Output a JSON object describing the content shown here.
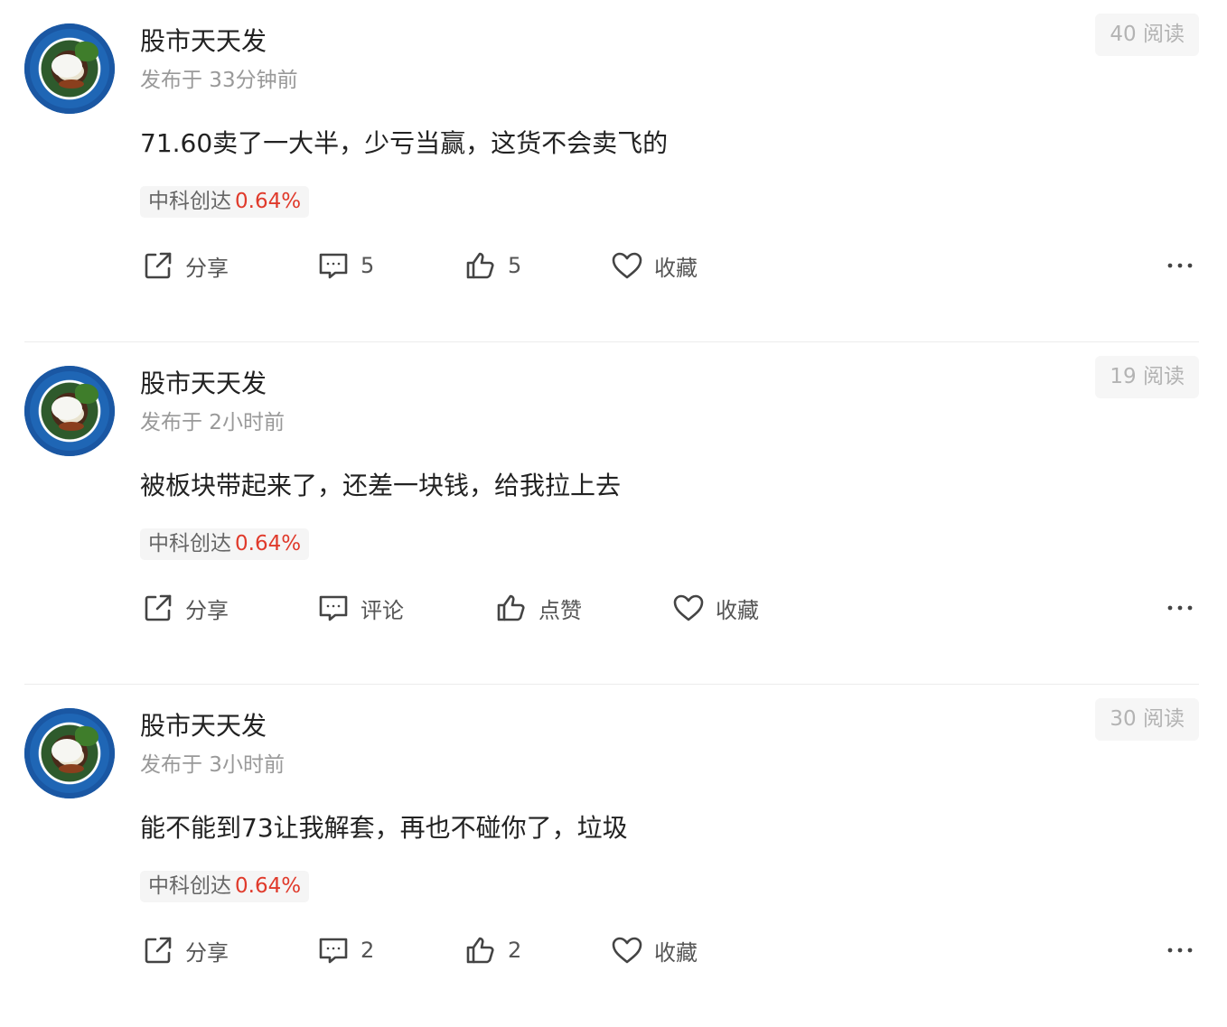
{
  "posts": [
    {
      "author": "股市天天发",
      "time": "发布于 33分钟前",
      "reads": "40 阅读",
      "content": "71.60卖了一大半，少亏当赢，这货不会卖飞的",
      "stock": "中科创达",
      "change": "0.64%",
      "share_label": "分享",
      "comment_label": "5",
      "like_label": "5",
      "fav_label": "收藏"
    },
    {
      "author": "股市天天发",
      "time": "发布于 2小时前",
      "reads": "19 阅读",
      "content": "被板块带起来了，还差一块钱，给我拉上去",
      "stock": "中科创达",
      "change": "0.64%",
      "share_label": "分享",
      "comment_label": "评论",
      "like_label": "点赞",
      "fav_label": "收藏"
    },
    {
      "author": "股市天天发",
      "time": "发布于 3小时前",
      "reads": "30 阅读",
      "content": "能不能到73让我解套，再也不碰你了，垃圾",
      "stock": "中科创达",
      "change": "0.64%",
      "share_label": "分享",
      "comment_label": "2",
      "like_label": "2",
      "fav_label": "收藏"
    }
  ],
  "colors": {
    "change_up": "#e03a2b",
    "muted": "#999999",
    "tag_bg": "#f5f5f5"
  },
  "icons": [
    "share-icon",
    "comment-icon",
    "thumbs-up-icon",
    "heart-icon",
    "more-icon"
  ]
}
